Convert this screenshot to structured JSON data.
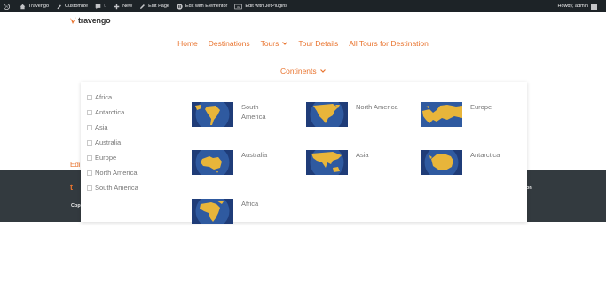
{
  "adminbar": {
    "site": "Travengo",
    "customize": "Customize",
    "comments": "0",
    "new": "New",
    "edit_page": "Edit Page",
    "elementor": "Edit with Elementor",
    "jet": "Edit with JetPlugins",
    "howdy": "Howdy, admin"
  },
  "logo": {
    "text": "travengo"
  },
  "nav": {
    "items": [
      "Home",
      "Destinations",
      "Tours",
      "Tour Details",
      "All Tours for Destination"
    ],
    "sub": "Continents"
  },
  "filter": {
    "options": [
      "Africa",
      "Antarctica",
      "Asia",
      "Australia",
      "Europe",
      "North America",
      "South America"
    ]
  },
  "continents": [
    {
      "name": "South America",
      "icon": "south-america-globe"
    },
    {
      "name": "North America",
      "icon": "north-america-globe"
    },
    {
      "name": "Europe",
      "icon": "europe-map"
    },
    {
      "name": "Australia",
      "icon": "australia-globe"
    },
    {
      "name": "Asia",
      "icon": "asia-globe"
    },
    {
      "name": "Antarctica",
      "icon": "antarctica-globe"
    },
    {
      "name": "Africa",
      "icon": "africa-globe"
    }
  ],
  "footer": {
    "edit": "Edi",
    "logo": "t",
    "copy": "Cop",
    "right": "on"
  },
  "colors": {
    "accent": "#e9742f",
    "ocean": "#2f5aa0",
    "land": "#e8b53a",
    "footer": "#333a3f",
    "adminbar": "#1d2327"
  }
}
